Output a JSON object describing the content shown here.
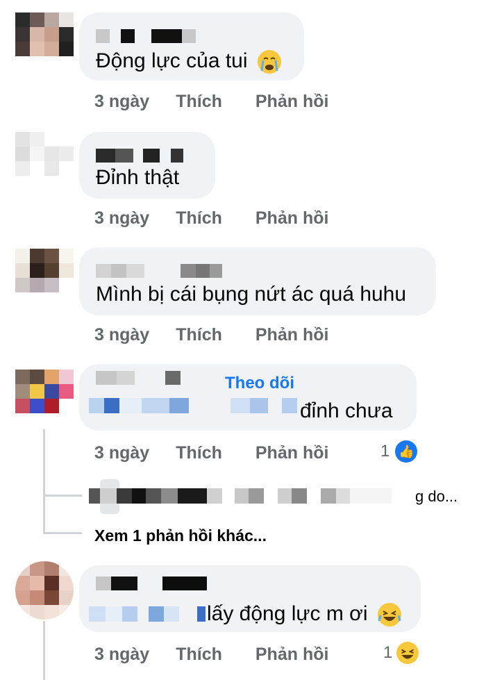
{
  "comments": [
    {
      "text": "Động lực của tui",
      "emoji": "crying-face",
      "time": "3 ngày",
      "like": "Thích",
      "reply": "Phản hồi"
    },
    {
      "text": "Đỉnh thật",
      "time": "3 ngày",
      "like": "Thích",
      "reply": "Phản hồi"
    },
    {
      "text": "Mình bị cái bụng nứt ác quá huhu",
      "time": "3 ngày",
      "like": "Thích",
      "reply": "Phản hồi"
    },
    {
      "follow": "Theo dõi",
      "text": "đỉnh chưa",
      "time": "3 ngày",
      "like": "Thích",
      "reply": "Phản hồi",
      "reaction_count": "1",
      "reaction": "like-icon",
      "reply_preview_tail": "g do...",
      "more_replies": "Xem 1 phản hồi khác..."
    },
    {
      "text": "lấy động lực m ơi",
      "emoji": "laughing-face",
      "time": "3 ngày",
      "like": "Thích",
      "reply": "Phản hồi",
      "reaction_count": "1",
      "reaction": "laugh-icon"
    }
  ],
  "colors": {
    "bubble": "#f0f2f5",
    "meta": "#65676b",
    "accent": "#1877f2",
    "emoji": "#f7c83b"
  }
}
